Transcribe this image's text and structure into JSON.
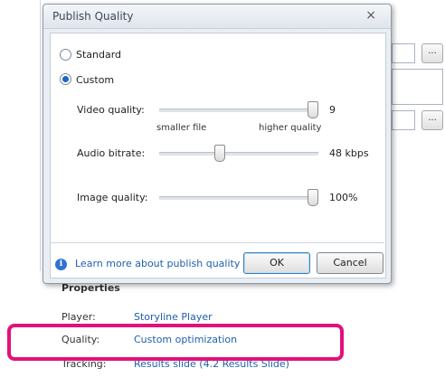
{
  "dialog": {
    "title": "Publish Quality",
    "close_symbol": "×",
    "options": {
      "standard_label": "Standard",
      "custom_label": "Custom",
      "selected": "Custom"
    },
    "sliders": {
      "video": {
        "label": "Video quality:",
        "value": "9",
        "level": 1.0
      },
      "audio": {
        "label": "Audio bitrate:",
        "value": "48 kbps",
        "level": 0.37
      },
      "image": {
        "label": "Image quality:",
        "value": "100%",
        "level": 1.0
      }
    },
    "hints": {
      "smaller": "smaller file",
      "higher": "higher quality"
    },
    "learn_more": "Learn more about publish quality",
    "ok_label": "OK",
    "cancel_label": "Cancel"
  },
  "background": {
    "ellipsis_label": "...",
    "properties": {
      "title": "Properties",
      "rows": [
        {
          "label": "Player:",
          "value": "Storyline Player"
        },
        {
          "label": "Quality:",
          "value": "Custom optimization"
        },
        {
          "label": "Tracking:",
          "value": "Results slide (4.2 Results Slide)"
        }
      ]
    }
  },
  "colors": {
    "highlight": "#e2117c",
    "link": "#1f5fad",
    "radio_selected": "#1a66c4"
  }
}
